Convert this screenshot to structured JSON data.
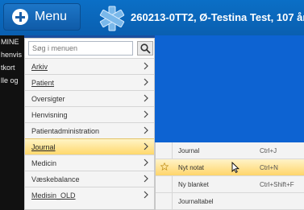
{
  "header": {
    "menu_label": "Menu",
    "patient_title": "260213-0TT2, Ø-Testina Test, 107 år"
  },
  "left_strip": [
    "MINE",
    "henvis",
    "tkort",
    "lle og"
  ],
  "menu": {
    "search_placeholder": "Søg i menuen",
    "items": [
      {
        "label": "Arkiv",
        "underline": true
      },
      {
        "label": "Patient",
        "underline": true
      },
      {
        "label": "Oversigter"
      },
      {
        "label": "Henvisning"
      },
      {
        "label": "Patientadministration"
      },
      {
        "label": "Journal",
        "underline": true,
        "active": true
      },
      {
        "label": "Medicin"
      },
      {
        "label": "Væskebalance"
      },
      {
        "label": "Medisin_OLD",
        "underline": true
      }
    ]
  },
  "submenu": {
    "items": [
      {
        "label": "Journal",
        "shortcut": "Ctrl+J"
      },
      {
        "label": "Nyt notat",
        "shortcut": "Ctrl+N",
        "highlighted": true
      },
      {
        "label": "Ny blanket",
        "shortcut": "Ctrl+Shift+F"
      },
      {
        "label": "Journaltabel",
        "shortcut": ""
      }
    ]
  }
}
